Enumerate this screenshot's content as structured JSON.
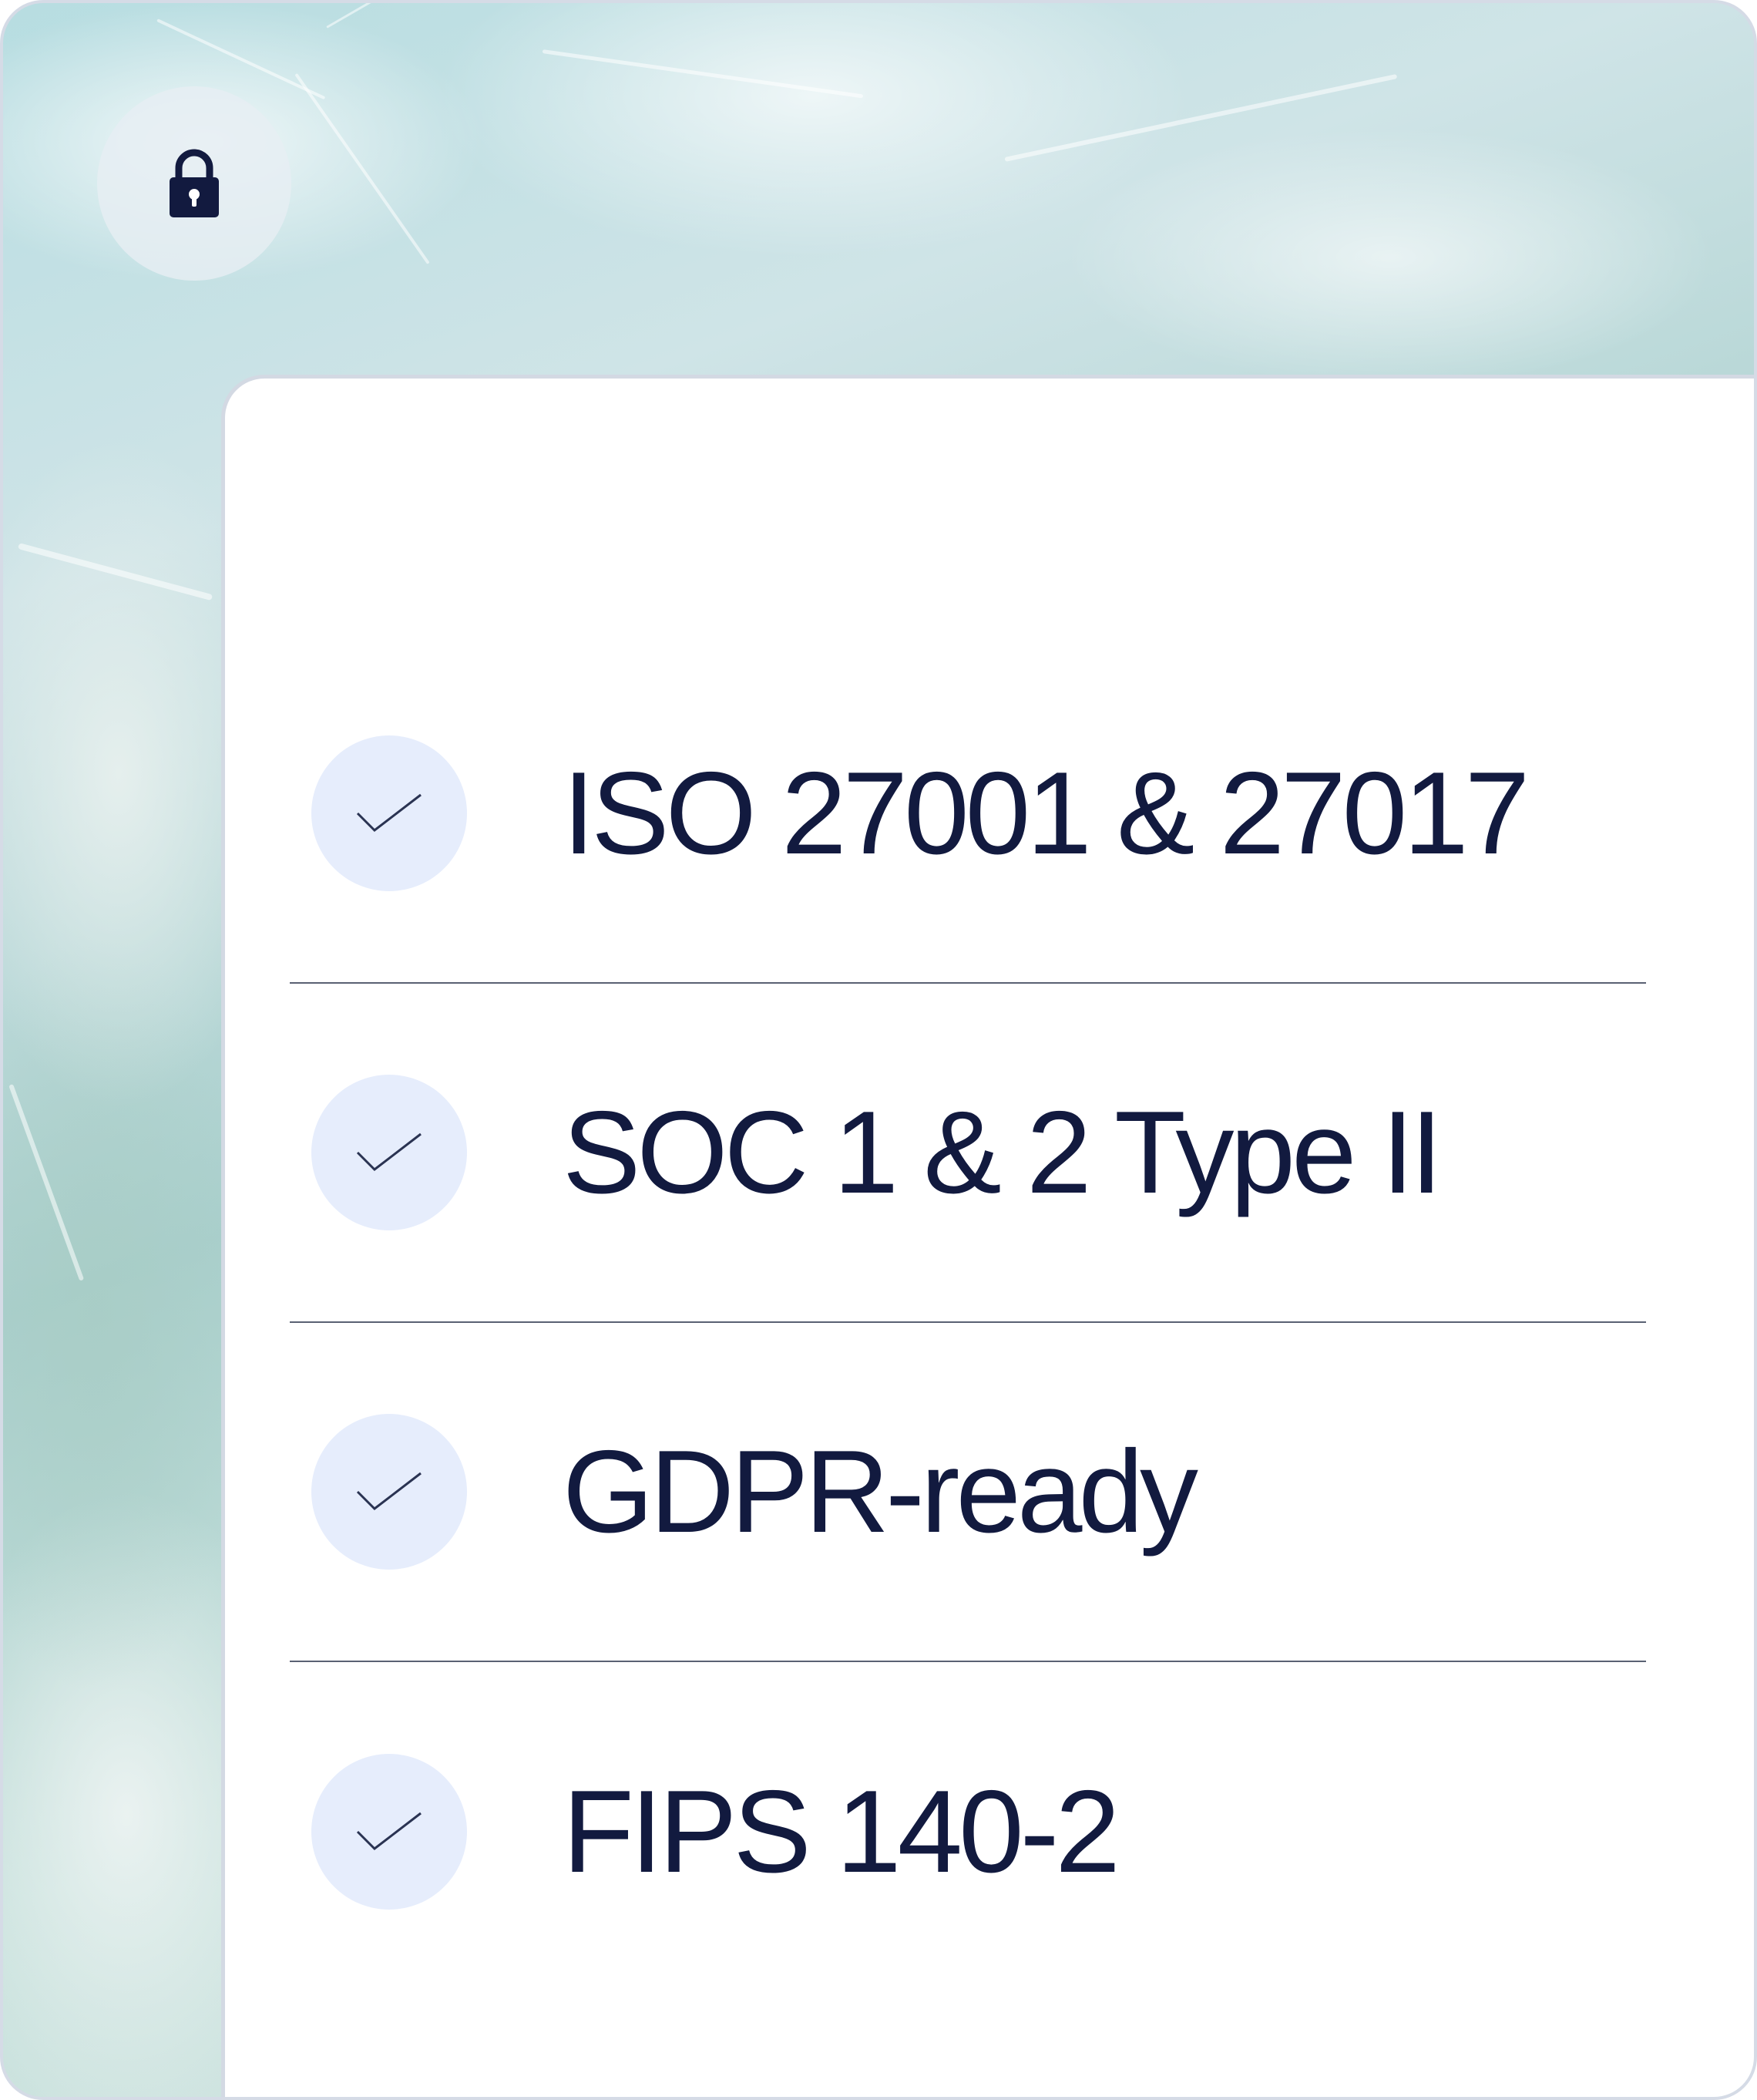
{
  "colors": {
    "text": "#121a3f",
    "check_background": "#e6edfc",
    "divider": "#5a6173",
    "lock_icon": "#121a3f"
  },
  "lock": {
    "icon": "lock-icon"
  },
  "certifications": [
    {
      "label": "ISO 27001 & 27017",
      "icon": "checkmark-icon"
    },
    {
      "label": "SOC 1 & 2 Type II",
      "icon": "checkmark-icon"
    },
    {
      "label": "GDPR-ready",
      "icon": "checkmark-icon"
    },
    {
      "label": "FIPS 140-2",
      "icon": "checkmark-icon"
    }
  ]
}
